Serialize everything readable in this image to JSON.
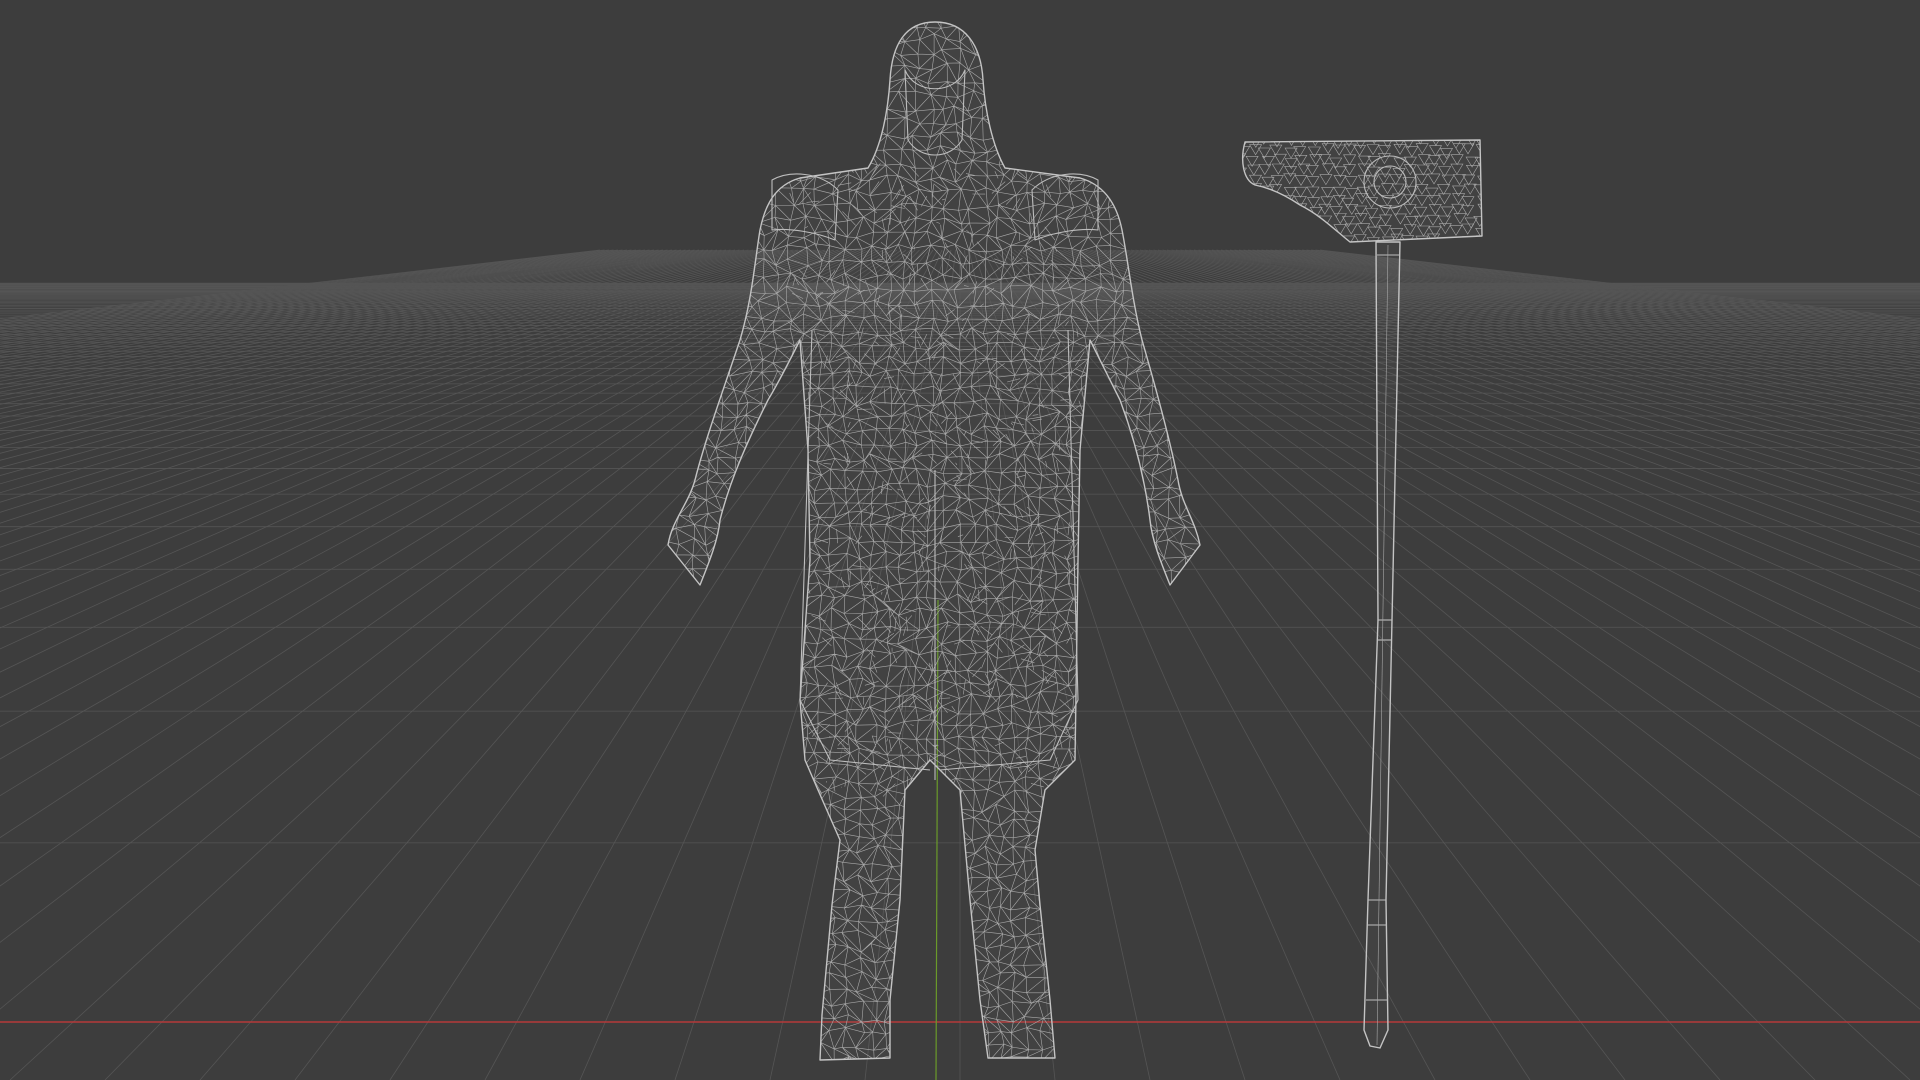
{
  "viewport": {
    "mode": "wireframe",
    "background_color": "#3d3d3d",
    "grid_line_color": "#555555",
    "x_axis_color": "#b5393a",
    "y_axis_color": "#6a9a2a",
    "wire_color": "#bdbdbd"
  },
  "objects": [
    {
      "name": "hooded-warrior",
      "kind": "character-mesh"
    },
    {
      "name": "war-hammer",
      "kind": "weapon-mesh"
    }
  ]
}
